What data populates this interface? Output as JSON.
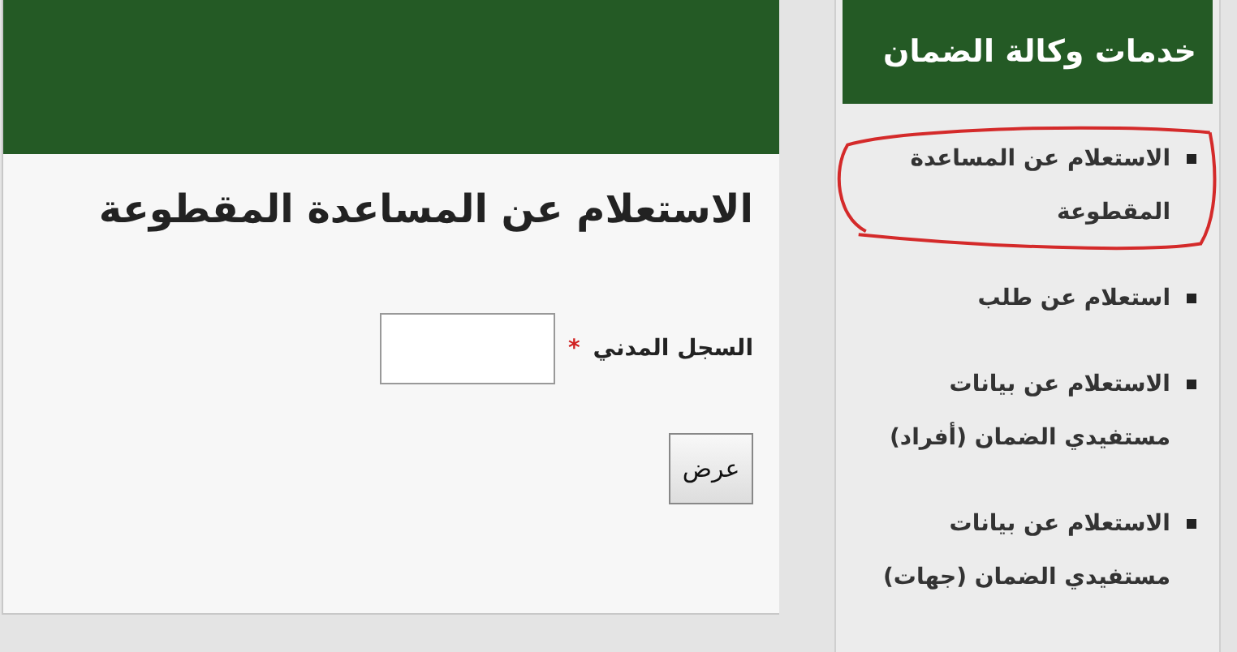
{
  "main": {
    "title": "الاستعلام عن المساعدة المقطوعة",
    "field": {
      "label": "السجل المدني",
      "required": true,
      "marker": "*"
    },
    "button": "عرض"
  },
  "sidebar": {
    "title": "خدمات وكالة الضمان",
    "items": [
      {
        "label": "الاستعلام عن المساعدة المقطوعة",
        "circled": true
      },
      {
        "label": "استعلام عن طلب",
        "circled": false
      },
      {
        "label": "الاستعلام عن بيانات مستفيدي الضمان (أفراد)",
        "circled": false
      },
      {
        "label": "الاستعلام عن بيانات مستفيدي الضمان (جهات)",
        "circled": false
      }
    ]
  }
}
